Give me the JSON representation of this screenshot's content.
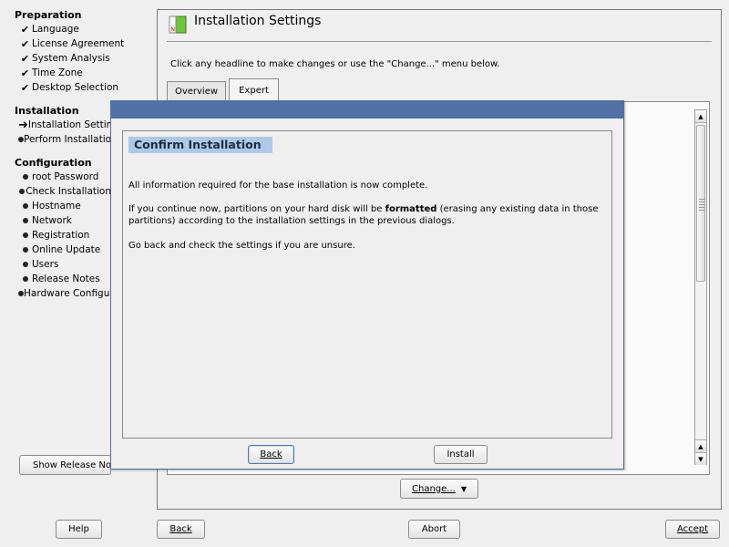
{
  "sidebar": {
    "sections": [
      {
        "title": "Preparation",
        "items": [
          {
            "label": "Language",
            "state": "done"
          },
          {
            "label": "License Agreement",
            "state": "done"
          },
          {
            "label": "System Analysis",
            "state": "done"
          },
          {
            "label": "Time Zone",
            "state": "done"
          },
          {
            "label": "Desktop Selection",
            "state": "done"
          }
        ]
      },
      {
        "title": "Installation",
        "items": [
          {
            "label": "Installation Settings",
            "state": "current"
          },
          {
            "label": "Perform Installation",
            "state": "pending"
          }
        ]
      },
      {
        "title": "Configuration",
        "items": [
          {
            "label": "root Password",
            "state": "pending"
          },
          {
            "label": "Check Installation",
            "state": "pending"
          },
          {
            "label": "Hostname",
            "state": "pending"
          },
          {
            "label": "Network",
            "state": "pending"
          },
          {
            "label": "Registration",
            "state": "pending"
          },
          {
            "label": "Online Update",
            "state": "pending"
          },
          {
            "label": "Users",
            "state": "pending"
          },
          {
            "label": "Release Notes",
            "state": "pending"
          },
          {
            "label": "Hardware Configuration",
            "state": "pending"
          }
        ]
      }
    ],
    "show_release_notes": "Show Release Notes"
  },
  "main": {
    "title": "Installation Settings",
    "hint": "Click any headline to make changes or use the \"Change...\" menu below.",
    "tabs": [
      "Overview",
      "Expert"
    ],
    "change_button": "Change..."
  },
  "dialog": {
    "heading": "Confirm Installation",
    "para1": "All information required for the base installation is now complete.",
    "para2_pre": "If you continue now, partitions on your hard disk will be ",
    "para2_bold": "formatted",
    "para2_post": " (erasing any existing data in those",
    "para2_line2": "partitions) according to the installation settings in the previous dialogs.",
    "para3": "Go back and check the settings if you are unsure.",
    "back": "Back",
    "install": "Install"
  },
  "bottom": {
    "help": "Help",
    "back": "Back",
    "abort": "Abort",
    "accept": "Accept"
  },
  "colors": {
    "titlebar": "#5070a6",
    "heading_bg": "#aec9e8"
  }
}
